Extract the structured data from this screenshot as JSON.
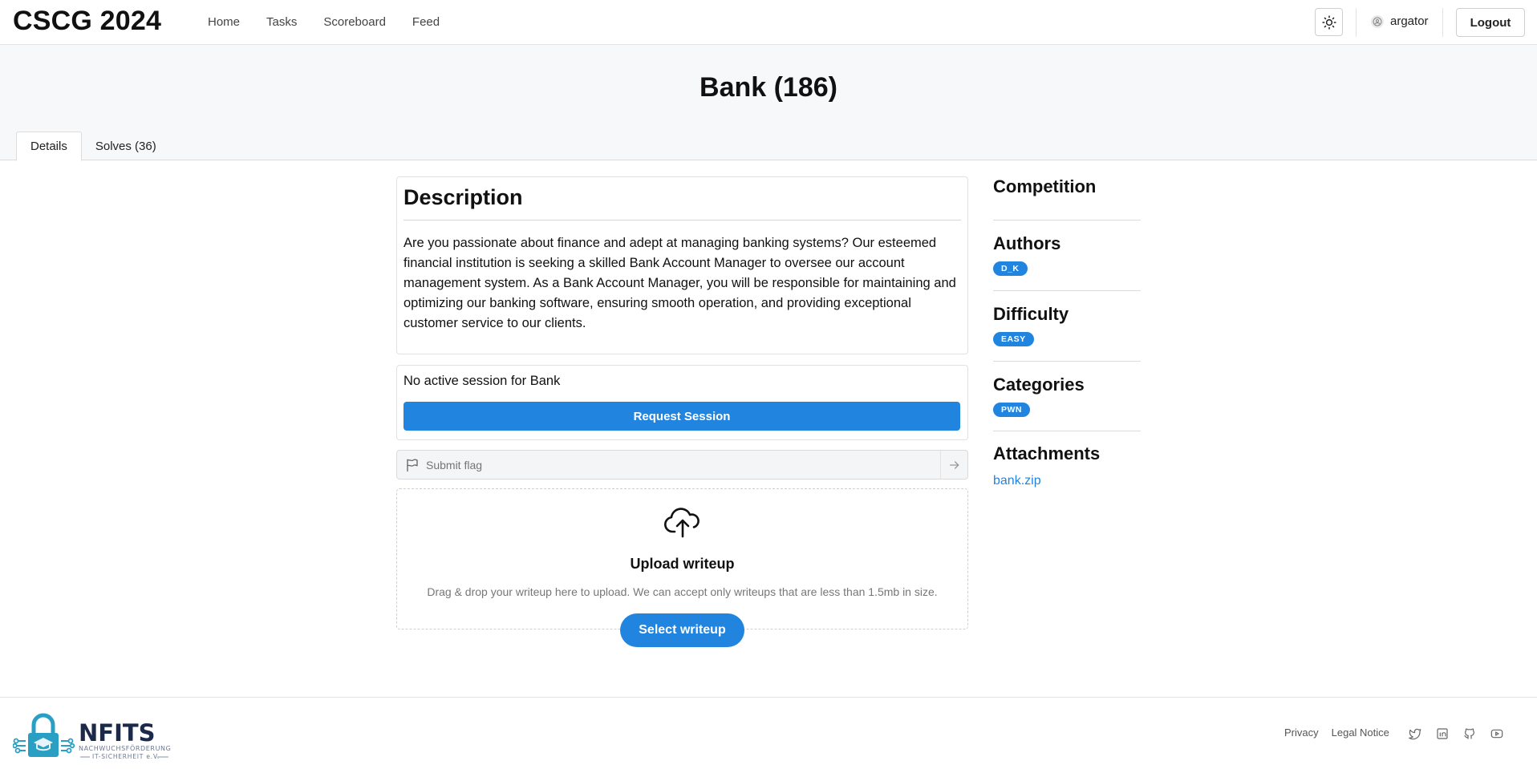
{
  "nav": {
    "brand": "CSCG 2024",
    "links": [
      "Home",
      "Tasks",
      "Scoreboard",
      "Feed"
    ],
    "username": "argator",
    "logout_label": "Logout",
    "icons": {
      "theme": "sun-icon",
      "user": "user-avatar-icon"
    }
  },
  "challenge": {
    "title": "Bank (186)",
    "tabs": [
      "Details",
      "Solves (36)"
    ],
    "active_tab": "Details"
  },
  "description": {
    "heading": "Description",
    "text": "Are you passionate about finance and adept at managing banking systems? Our esteemed financial institution is seeking a skilled Bank Account Manager to oversee our account management system. As a Bank Account Manager, you will be responsible for maintaining and optimizing our banking software, ensuring smooth operation, and providing exceptional customer service to our clients."
  },
  "session": {
    "status_text": "No active session for Bank",
    "request_label": "Request Session"
  },
  "flag": {
    "placeholder": "Submit flag"
  },
  "upload": {
    "title": "Upload writeup",
    "hint": "Drag & drop your writeup here to upload. We can accept only writeups that are less than 1.5mb in size.",
    "button_label": "Select writeup"
  },
  "sidebar": {
    "competition_title": "Competition",
    "authors_title": "Authors",
    "authors": [
      "D_K"
    ],
    "difficulty_title": "Difficulty",
    "difficulty": "EASY",
    "categories_title": "Categories",
    "categories": [
      "PWN"
    ],
    "attachments_title": "Attachments",
    "attachments": [
      "bank.zip"
    ]
  },
  "footer": {
    "logo_text": "NFITS",
    "logo_subtitle_1": "NACHWUCHSFÖRDERUNG",
    "logo_subtitle_2": "IT-SICHERHEIT e.V.",
    "links": [
      "Privacy",
      "Legal Notice"
    ],
    "socials": [
      "twitter-icon",
      "linkedin-icon",
      "github-icon",
      "youtube-icon"
    ]
  },
  "colors": {
    "accent": "#2185e0",
    "header_band": "#f7f8fa",
    "logo_dark": "#1b2a4a",
    "logo_teal": "#2a9fc4"
  }
}
